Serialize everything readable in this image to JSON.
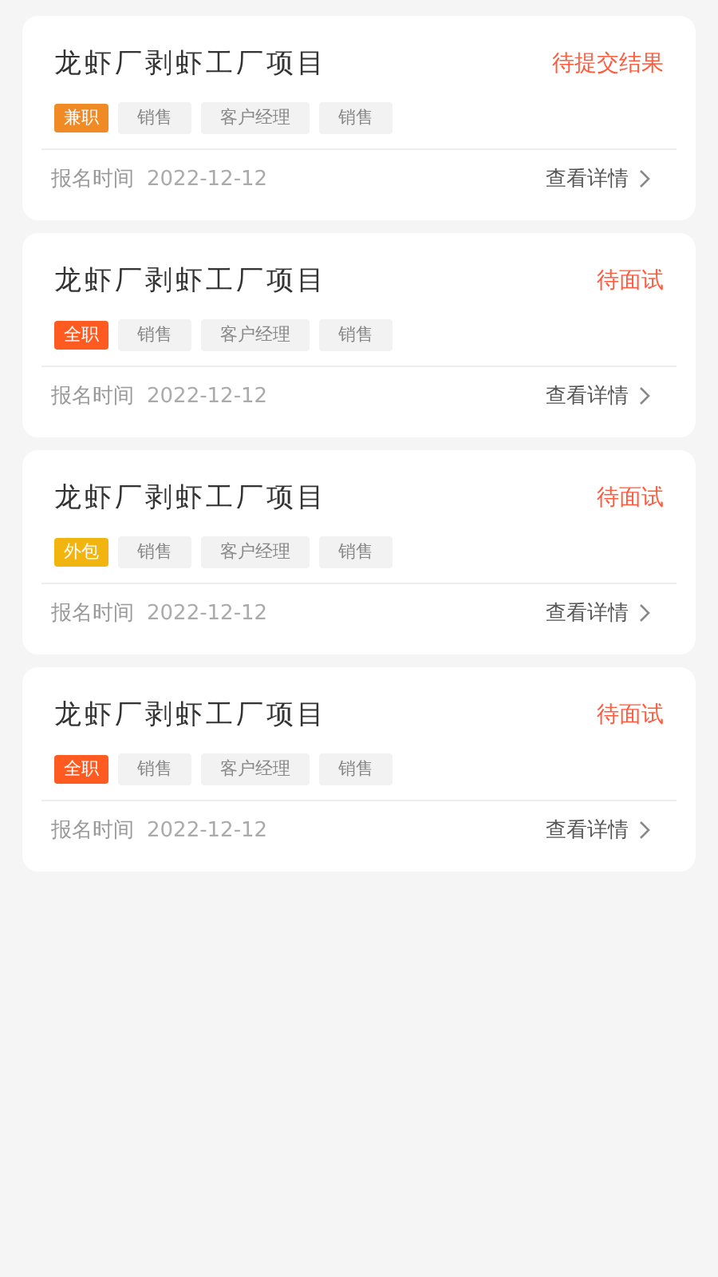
{
  "applications": [
    {
      "title": "龙虾厂剥虾工厂项目",
      "status": "待提交结果",
      "tags": [
        {
          "label": "兼职",
          "kind": "type",
          "color": "#f08a24"
        },
        {
          "label": "销售",
          "kind": "plain"
        },
        {
          "label": "客户经理",
          "kind": "plain"
        },
        {
          "label": "销售",
          "kind": "plain"
        }
      ],
      "date_label": "报名时间",
      "date": "2022-12-12",
      "details_link": "查看详情"
    },
    {
      "title": "龙虾厂剥虾工厂项目",
      "status": "待面试",
      "tags": [
        {
          "label": "全职",
          "kind": "type",
          "color": "#ff5a1f"
        },
        {
          "label": "销售",
          "kind": "plain"
        },
        {
          "label": "客户经理",
          "kind": "plain"
        },
        {
          "label": "销售",
          "kind": "plain"
        }
      ],
      "date_label": "报名时间",
      "date": "2022-12-12",
      "details_link": "查看详情"
    },
    {
      "title": "龙虾厂剥虾工厂项目",
      "status": "待面试",
      "tags": [
        {
          "label": "外包",
          "kind": "type",
          "color": "#f2b40f"
        },
        {
          "label": "销售",
          "kind": "plain"
        },
        {
          "label": "客户经理",
          "kind": "plain"
        },
        {
          "label": "销售",
          "kind": "plain"
        }
      ],
      "date_label": "报名时间",
      "date": "2022-12-12",
      "details_link": "查看详情"
    },
    {
      "title": "龙虾厂剥虾工厂项目",
      "status": "待面试",
      "tags": [
        {
          "label": "全职",
          "kind": "type",
          "color": "#ff5a1f"
        },
        {
          "label": "销售",
          "kind": "plain"
        },
        {
          "label": "客户经理",
          "kind": "plain"
        },
        {
          "label": "销售",
          "kind": "plain"
        }
      ],
      "date_label": "报名时间",
      "date": "2022-12-12",
      "details_link": "查看详情"
    }
  ]
}
